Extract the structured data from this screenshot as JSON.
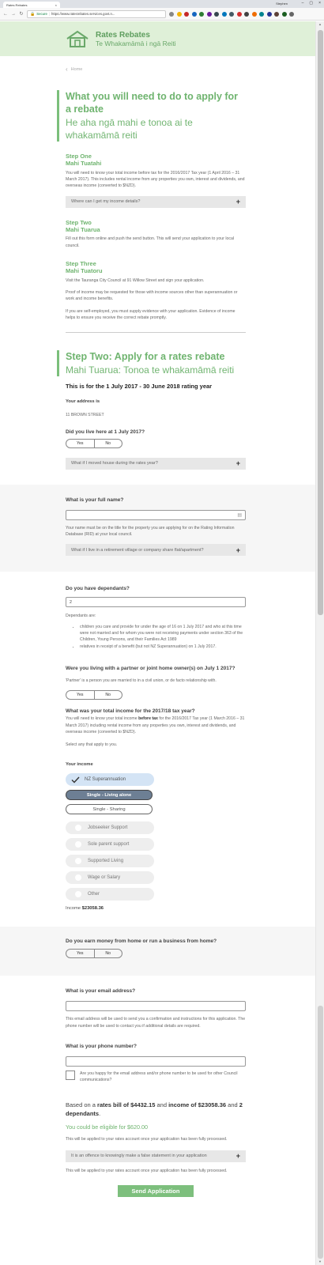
{
  "browser": {
    "tab_title": "Rates Rebates",
    "tab_close": "×",
    "user_label": "Stephen",
    "min": "–",
    "max": "▢",
    "close": "×",
    "back": "←",
    "forward": "→",
    "reload": "↻",
    "secure_label": "Secure",
    "url": "https://www.ratesrebates.services.govt.n..."
  },
  "header": {
    "title": "Rates Rebates",
    "subtitle": "Te Whakamāmā i ngā Reiti"
  },
  "breadcrumb": {
    "home": "Home"
  },
  "section1": {
    "title": "What you will need to do to apply for a rebate",
    "subtitle": "He aha ngā mahi e tonoa ai te whakamāmā reiti",
    "step1_en": "Step One",
    "step1_mi": "Mahi Tuatahi",
    "step1_text": "You will need to know your total income before tax for the 2016/2017 Tax year (1 April 2016 – 31 March 2017). This includes rental income from any properties you own, interest and dividends, and overseas income (converted to $NZD).",
    "income_acc": "Where can I get my income details?",
    "step2_en": "Step Two",
    "step2_mi": "Mahi Tuarua",
    "step2_text": "Fill out this form online and push the send button. This will send your application to your local council.",
    "step3_en": "Step Three",
    "step3_mi": "Mahi Tuatoru",
    "step3_text1": "Visit the Tauranga City Council at 91 Willow Street and sign your application.",
    "step3_text2": "Proof of income may be requested for those with income sources other than superannuation or work and income benefits.",
    "step3_text3": "If you are self-employed, you must supply evidence with your application. Evidence of income helps to ensure you receive the correct rebate promptly."
  },
  "section2": {
    "title": "Step Two: Apply for a rates rebate",
    "subtitle": "Mahi Tuarua: Tonoa te whakamāmā reiti",
    "period": "This is for the 1 July 2017 - 30 June 2018 rating year",
    "address_label": "Your address is",
    "address": "11 BROWN STREET",
    "live_q": "Did you live here at 1 July 2017?",
    "yes": "Yes",
    "no": "No",
    "moved_acc": "What if I moved house during the rates year?"
  },
  "fullname": {
    "question": "What is your full name?",
    "value": "",
    "help": "Your name must be on the title for the property you are applying for on the Rating Information Database (RID) at your local council.",
    "retirement_acc": "What if I live in a retirement village or company share flat/apartment?"
  },
  "dependants": {
    "question": "Do you have dependants?",
    "value": "2",
    "are_label": "Dependants are:",
    "bullet1": "children you care and provide for under the age of 16 on 1 July 2017 and who at this time were not married and for whom you were not receiving payments under section 363 of the Children, Young Persons, and their Families Act 1989",
    "bullet2": "relatives in receipt of a benefit (but not NZ Superannuation) on 1 July 2017.",
    "partner_q": "Were you living with a partner or joint home owner(s) on July 1 2017?",
    "partner_help": "'Partner' is a person you are married to in a civil union, or de facto relationship with.",
    "income_q": "What was your total income for the 2017/18 tax year?",
    "income_help_a": "You will need to know your total income ",
    "income_help_bold": "before tax",
    "income_help_b": " for the 2016/2017 Tax year (1 March 2016 – 31 March 2017) including rental income from any properties you own, interest and dividends, and overseas income (converted to $NZD).",
    "select_all": "Select any that apply to you.",
    "your_income": "Your income",
    "opt_super": "NZ Superannuation",
    "opt_single_alone": "Single - Living alone",
    "opt_single_sharing": "Single - Sharing",
    "opt_jobseeker": "Jobseeker Support",
    "opt_sole_parent": "Sole parent support",
    "opt_supported": "Supported Living",
    "opt_wage": "Wage or Salary",
    "opt_other": "Other",
    "income_label": "Income ",
    "income_value": "$23058.36"
  },
  "business": {
    "question": "Do you earn money from home or run a business from home?"
  },
  "contact": {
    "email_q": "What is your email address?",
    "email_value": "",
    "email_help": "This email address will be used to send you a confirmation and instructions for this application. The phone number will be used to contact you if additional details are required.",
    "phone_q": "What is your phone number?",
    "phone_value": "",
    "consent": "Are you happy for the email address and/or phone number to be used for other Council communications?"
  },
  "summary": {
    "based_on": "Based on a ",
    "rates_bill": "rates bill of $4432.15",
    "and1": " and ",
    "income": "income of $23058.36",
    "and2": " and ",
    "dependants": "2 dependants",
    "period": ".",
    "eligible": "You could be eligible for $620.00",
    "applied1": "This will be applied to your rates account once your application has been fully processed.",
    "offence_acc": "It is an offence to knowingly make a false statement in your application",
    "applied2": "This will be applied to your rates account once your application has been fully processed.",
    "send": "Send Application"
  },
  "colors": {
    "accent": "#6fb46f",
    "header_bg": "#dff0d8",
    "selected_pill": "#d4e4f5",
    "dark_pill": "#6d7f94"
  }
}
